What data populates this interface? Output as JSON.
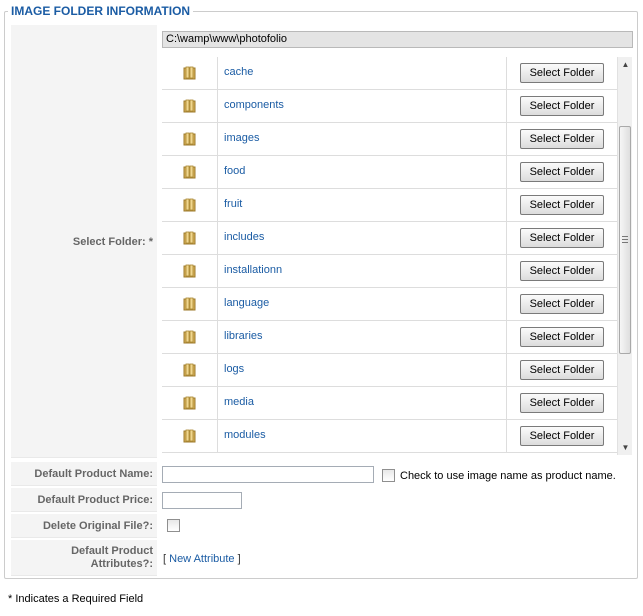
{
  "legend": "IMAGE FOLDER INFORMATION",
  "fields": {
    "select_folder_label": "Select Folder: *",
    "product_name_label": "Default Product Name:",
    "product_price_label": "Default Product Price:",
    "delete_file_label": "Delete Original File?:",
    "attributes_label_line1": "Default Product",
    "attributes_label_line2": "Attributes?:"
  },
  "path": "C:\\wamp\\www\\photofolio",
  "select_button_label": "Select Folder",
  "folders": [
    {
      "name": "cache"
    },
    {
      "name": "components"
    },
    {
      "name": "images"
    },
    {
      "name": "food"
    },
    {
      "name": "fruit"
    },
    {
      "name": "includes"
    },
    {
      "name": "installationn"
    },
    {
      "name": "language"
    },
    {
      "name": "libraries"
    },
    {
      "name": "logs"
    },
    {
      "name": "media"
    },
    {
      "name": "modules"
    }
  ],
  "product_name": {
    "value": "",
    "checkbox_label": "Check to use image name as product name.",
    "checked": false
  },
  "product_price": {
    "value": ""
  },
  "delete_original": {
    "checked": false
  },
  "attributes": {
    "open_bracket": "[ ",
    "link": "New Attribute",
    "close_bracket": " ]"
  },
  "footnote": "* Indicates a Required Field",
  "colors": {
    "accent": "#1b5ca4",
    "key_bg": "#f4f4f4",
    "path_bg": "#e4e4e4"
  },
  "icons": {
    "folder": "folder-icon",
    "scroll_up": "arrow-up-icon",
    "scroll_down": "arrow-down-icon"
  }
}
